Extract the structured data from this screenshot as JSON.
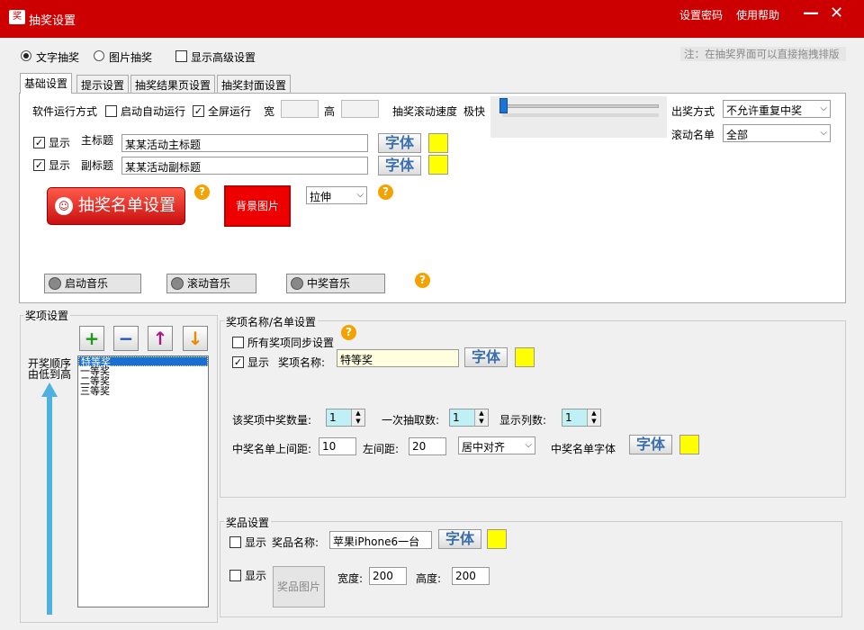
{
  "window": {
    "title": "抽奖设置",
    "icon_text": "奖",
    "links": [
      "设置密码",
      "使用帮助"
    ],
    "minimize_label": "—",
    "close_label": "✕"
  },
  "top_options": {
    "mode_text": "文字抽奖",
    "mode_image": "图片抽奖",
    "show_advanced": "显示高级设置",
    "note": "注：在抽奖界面可以直接拖拽排版"
  },
  "tabs": [
    "基础设置",
    "提示设置",
    "抽奖结果页设置",
    "抽奖封面设置"
  ],
  "basic": {
    "run_mode_label": "软件运行方式",
    "auto_start": "启动自动运行",
    "fullscreen": "全屏运行",
    "width_label": "宽",
    "height_label": "高",
    "speed_label": "抽奖滚动速度",
    "speed_fast": "极快",
    "draw_mode_label": "出奖方式",
    "draw_mode_value": "不允许重复中奖",
    "scroll_list_label": "滚动名单",
    "scroll_list_value": "全部",
    "show_label": "显示",
    "main_title_label": "主标题",
    "main_title_value": "某某活动主标题",
    "sub_title_label": "副标题",
    "sub_title_value": "某某活动副标题",
    "font_label": "字体",
    "draw_list_button": "抽奖名单设置",
    "bg_image_label": "背景图片",
    "bg_stretch_value": "拉伸",
    "music_start": "启动音乐",
    "music_scroll": "滚动音乐",
    "music_win": "中奖音乐",
    "help_symbol": "?"
  },
  "prizes": {
    "group_title": "奖项设置",
    "order_label_1": "开奖顺序",
    "order_label_2": "由低到高",
    "add": "+",
    "remove": "−",
    "up": "↑",
    "down": "↓",
    "items": [
      "特等奖",
      "一等奖",
      "二等奖",
      "三等奖"
    ]
  },
  "prize_name": {
    "group_title": "奖项名称/名单设置",
    "sync_all": "所有奖项同步设置",
    "show_label": "显示",
    "name_label": "奖项名称:",
    "name_value": "特等奖",
    "font_label": "字体",
    "count_label": "该奖项中奖数量:",
    "count_value": "1",
    "per_draw_label": "一次抽取数:",
    "per_draw_value": "1",
    "columns_label": "显示列数:",
    "columns_value": "1",
    "top_margin_label": "中奖名单上间距:",
    "top_margin_value": "10",
    "left_margin_label": "左间距:",
    "left_margin_value": "20",
    "align_value": "居中对齐",
    "list_font_label": "中奖名单字体"
  },
  "gift": {
    "group_title": "奖品设置",
    "show_label": "显示",
    "name_label": "奖品名称:",
    "name_value": "苹果iPhone6一台",
    "font_label": "字体",
    "image_label": "奖品图片",
    "width_label": "宽度:",
    "width_value": "200",
    "height_label": "高度:",
    "height_value": "200"
  },
  "colors": {
    "titlebar": "#cc0000",
    "swatch": "#ffff00",
    "selection": "#1a6fd0"
  }
}
